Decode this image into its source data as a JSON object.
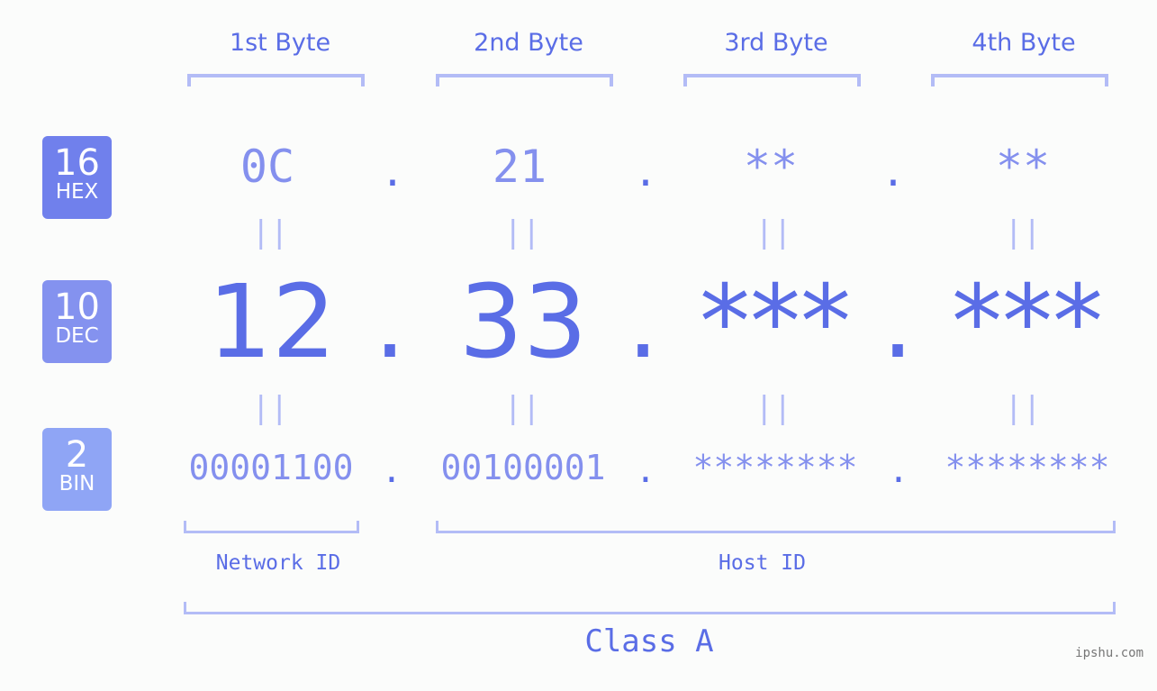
{
  "bytes": [
    {
      "label": "1st Byte",
      "hex": "0C",
      "dec": "12",
      "bin": "00001100"
    },
    {
      "label": "2nd Byte",
      "hex": "21",
      "dec": "33",
      "bin": "00100001"
    },
    {
      "label": "3rd Byte",
      "hex": "**",
      "dec": "***",
      "bin": "********"
    },
    {
      "label": "4th Byte",
      "hex": "**",
      "dec": "***",
      "bin": "********"
    }
  ],
  "bases": {
    "hex": {
      "num": "16",
      "label": "HEX",
      "color": "#7080ec"
    },
    "dec": {
      "num": "10",
      "label": "DEC",
      "color": "#8492ef"
    },
    "bin": {
      "num": "2",
      "label": "BIN",
      "color": "#8fa5f5"
    }
  },
  "separator": ".",
  "equals": "||",
  "network_id_label": "Network ID",
  "host_id_label": "Host ID",
  "class_label": "Class A",
  "watermark": "ipshu.com",
  "colors": {
    "primary": "#5a6de6",
    "secondary": "#8490ee",
    "bracket": "#b3bcf6",
    "background": "#fbfcfb"
  }
}
